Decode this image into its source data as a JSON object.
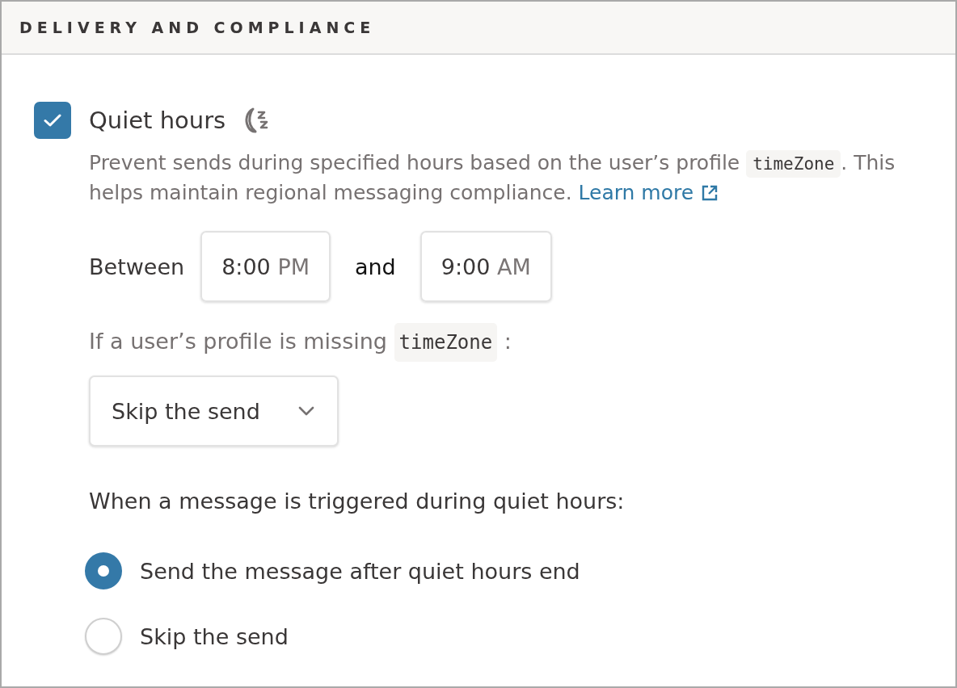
{
  "section": {
    "title": "DELIVERY AND COMPLIANCE"
  },
  "quiet_hours": {
    "label": "Quiet hours",
    "checked": true,
    "description": {
      "text_1": "Prevent sends during specified hours based on the user’s profile",
      "code": "timeZone",
      "text_2": ". This helps maintain regional messaging compliance.",
      "link": "Learn more"
    },
    "between_label": "Between",
    "start": {
      "time": "8:00",
      "period": "PM"
    },
    "and_label": "and",
    "end": {
      "time": "9:00",
      "period": "AM"
    },
    "missing_prompt": {
      "text": "If a user’s profile is missing",
      "code": "timeZone",
      "suffix": ":"
    },
    "fallback_select": {
      "value": "Skip the send"
    },
    "trigger_prompt": "When a message is triggered during quiet hours:",
    "trigger_options": [
      {
        "label": "Send the message after quiet hours end",
        "selected": true
      },
      {
        "label": "Skip the send",
        "selected": false
      }
    ]
  }
}
